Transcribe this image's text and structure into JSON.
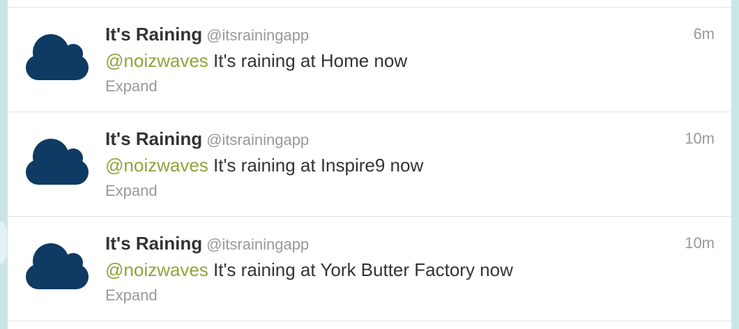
{
  "colors": {
    "background": "#c9e6e6",
    "card": "#ffffff",
    "name": "#333333",
    "secondary": "#999999",
    "mention": "#8ea53a",
    "avatar_cloud": "#0e3a63"
  },
  "avatar_icon": "cloud-icon",
  "tweets": [
    {
      "name": "It's Raining",
      "handle": "@itsrainingapp",
      "time": "6m",
      "mention": "@noizwaves",
      "text": " It's raining at Home now",
      "expand": "Expand"
    },
    {
      "name": "It's Raining",
      "handle": "@itsrainingapp",
      "time": "10m",
      "mention": "@noizwaves",
      "text": " It's raining at Inspire9 now",
      "expand": "Expand"
    },
    {
      "name": "It's Raining",
      "handle": "@itsrainingapp",
      "time": "10m",
      "mention": "@noizwaves",
      "text": " It's raining at York Butter Factory now",
      "expand": "Expand"
    }
  ]
}
